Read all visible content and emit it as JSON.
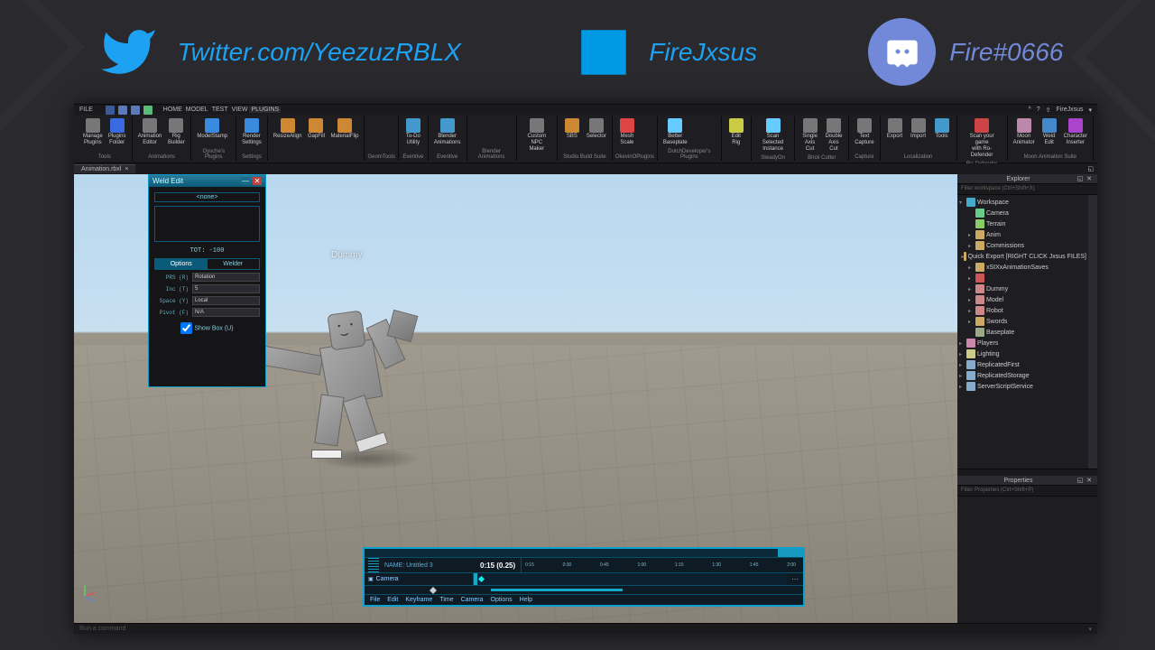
{
  "header": {
    "twitter": "Twitter.com/YeezuzRBLX",
    "brand": "FireJxsus",
    "discord": "Fire#0666"
  },
  "menubar": {
    "file": "FILE",
    "tabs": [
      "HOME",
      "MODEL",
      "TEST",
      "VIEW",
      "PLUGINS"
    ],
    "active_tab": 4,
    "username": "FireJxsus"
  },
  "ribbon": {
    "groups": [
      {
        "label": "Tools",
        "items": [
          {
            "l1": "Manage",
            "l2": "Plugins",
            "c": "#777"
          },
          {
            "l1": "Plugins",
            "l2": "Folder",
            "c": "#3a6adf"
          }
        ]
      },
      {
        "label": "Animations",
        "items": [
          {
            "l1": "Animation",
            "l2": "Editor",
            "c": "#777"
          },
          {
            "l1": "Rig",
            "l2": "Builder",
            "c": "#777"
          }
        ]
      },
      {
        "label": "Oysche's Plugins",
        "items": [
          {
            "l1": "ModelStamp",
            "l2": "",
            "c": "#3a8adf"
          }
        ]
      },
      {
        "label": "Settings",
        "items": [
          {
            "l1": "Render",
            "l2": "Settings",
            "c": "#3a8adf"
          }
        ]
      },
      {
        "label": "",
        "items": [
          {
            "l1": "ResizeAlign",
            "l2": "",
            "c": "#c83"
          },
          {
            "l1": "GapFill",
            "l2": "",
            "c": "#c83"
          },
          {
            "l1": "MaterialFlip",
            "l2": "",
            "c": "#c83"
          }
        ]
      },
      {
        "label": "GeomTools",
        "items": []
      },
      {
        "label": "Eventive",
        "items": [
          {
            "l1": "To-Do",
            "l2": "Utility",
            "c": "#49c"
          }
        ]
      },
      {
        "label": "Eventive",
        "items": [
          {
            "l1": "Blender",
            "l2": "Animations",
            "c": "#49c"
          }
        ]
      },
      {
        "label": "Blender Animations",
        "items": []
      },
      {
        "label": "",
        "items": [
          {
            "l1": "Custom NPC",
            "l2": "Maker",
            "c": "#777"
          }
        ]
      },
      {
        "label": "Studio Build Suite",
        "items": [
          {
            "l1": "SBS",
            "l2": "",
            "c": "#c83"
          },
          {
            "l1": "Selector",
            "l2": "",
            "c": "#777"
          }
        ]
      },
      {
        "label": "OkevinOPlugins",
        "items": [
          {
            "l1": "Mesh",
            "l2": "Scale",
            "c": "#d44"
          }
        ]
      },
      {
        "label": "DutchDeveloper's Plugins",
        "items": [
          {
            "l1": "Better",
            "l2": "Baseplate",
            "c": "#6cf"
          }
        ]
      },
      {
        "label": "",
        "items": [
          {
            "l1": "Edit",
            "l2": "Rig",
            "c": "#cc4"
          }
        ]
      },
      {
        "label": "SteadyOn",
        "items": [
          {
            "l1": "Scan Selected",
            "l2": "Instance",
            "c": "#6cf"
          }
        ]
      },
      {
        "label": "Brick Cutter",
        "items": [
          {
            "l1": "Single",
            "l2": "Axis Cut",
            "c": "#777"
          },
          {
            "l1": "Double",
            "l2": "Axis Cut",
            "c": "#777"
          }
        ]
      },
      {
        "label": "Capture",
        "items": [
          {
            "l1": "Text",
            "l2": "Capture",
            "c": "#777"
          }
        ]
      },
      {
        "label": "Localization",
        "items": [
          {
            "l1": "Export",
            "l2": "",
            "c": "#777"
          },
          {
            "l1": "Import",
            "l2": "",
            "c": "#777"
          },
          {
            "l1": "Tools",
            "l2": "",
            "c": "#49c"
          }
        ]
      },
      {
        "label": "Ro-Defender Plugin",
        "items": [
          {
            "l1": "Scan your game",
            "l2": "with Ro-Defender",
            "c": "#c44"
          }
        ]
      },
      {
        "label": "Moon Animation Suite",
        "items": [
          {
            "l1": "Moon",
            "l2": "Animator",
            "c": "#b8a"
          },
          {
            "l1": "Weld",
            "l2": "Edit",
            "c": "#48c"
          },
          {
            "l1": "Character",
            "l2": "Inserter",
            "c": "#a4c"
          }
        ]
      }
    ]
  },
  "doctab": {
    "name": "Animation.rbxl",
    "close": "×"
  },
  "weld": {
    "title": "Weld Edit",
    "none": "<none>",
    "tot": "TOT: -100",
    "tabs": [
      "Options",
      "Welder"
    ],
    "rows": [
      {
        "lbl": "PRS (R)",
        "val": "Rotation"
      },
      {
        "lbl": "Inc (T)",
        "val": "5"
      },
      {
        "lbl": "Space (Y)",
        "val": "Local"
      },
      {
        "lbl": "Pivot (F)",
        "val": "N/A"
      }
    ],
    "showbox": "Show Box (U)"
  },
  "viewport": {
    "dummy_name": "Dummy"
  },
  "anim": {
    "name": "NAME: Untitled 3",
    "time": "0:15 (0.25)",
    "ticks": [
      "0:15",
      "0:30",
      "0:45",
      "1:00",
      "1:15",
      "1:30",
      "1:45",
      "2:00"
    ],
    "track": "Camera",
    "menu": [
      "File",
      "Edit",
      "Keyframe",
      "Time",
      "Camera",
      "Options",
      "Help"
    ]
  },
  "explorer": {
    "title": "Explorer",
    "filter": "Filter workspace (Ctrl+Shift+X)",
    "items": [
      {
        "ind": 0,
        "arr": "▾",
        "ic": "#4ac",
        "t": "Workspace"
      },
      {
        "ind": 1,
        "arr": "",
        "ic": "#6c8",
        "t": "Camera"
      },
      {
        "ind": 1,
        "arr": "",
        "ic": "#8c6",
        "t": "Terrain"
      },
      {
        "ind": 1,
        "arr": "▸",
        "ic": "#ca6",
        "t": "Anim"
      },
      {
        "ind": 1,
        "arr": "▸",
        "ic": "#ca6",
        "t": "Commissions"
      },
      {
        "ind": 1,
        "arr": "▸",
        "ic": "#ca6",
        "t": "Quick Export [RIGHT CLICK Jxsus FILES]"
      },
      {
        "ind": 1,
        "arr": "▸",
        "ic": "#ca6",
        "t": "xSIXxAnimationSaves"
      },
      {
        "ind": 1,
        "arr": "▸",
        "ic": "#c55",
        "t": ""
      },
      {
        "ind": 1,
        "arr": "▸",
        "ic": "#c88",
        "t": "Dummy"
      },
      {
        "ind": 1,
        "arr": "▸",
        "ic": "#c88",
        "t": "Model"
      },
      {
        "ind": 1,
        "arr": "▸",
        "ic": "#c88",
        "t": "Robot"
      },
      {
        "ind": 1,
        "arr": "▸",
        "ic": "#ca6",
        "t": "Swords"
      },
      {
        "ind": 1,
        "arr": "",
        "ic": "#9a8",
        "t": "Baseplate"
      },
      {
        "ind": 0,
        "arr": "▸",
        "ic": "#c8a",
        "t": "Players"
      },
      {
        "ind": 0,
        "arr": "▸",
        "ic": "#cc8",
        "t": "Lighting"
      },
      {
        "ind": 0,
        "arr": "▸",
        "ic": "#8ac",
        "t": "ReplicatedFirst"
      },
      {
        "ind": 0,
        "arr": "▸",
        "ic": "#8ac",
        "t": "ReplicatedStorage"
      },
      {
        "ind": 0,
        "arr": "▸",
        "ic": "#8ac",
        "t": "ServerScriptService"
      }
    ]
  },
  "properties": {
    "title": "Properties",
    "filter": "Filter Properties (Ctrl+Shift+P)"
  },
  "cmdbar": "Run a command"
}
